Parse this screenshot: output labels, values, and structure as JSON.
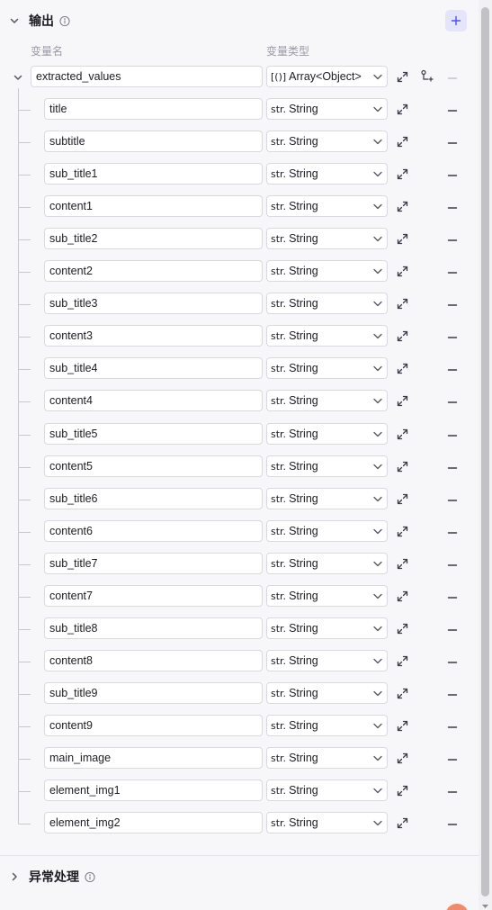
{
  "output_section": {
    "title": "输出",
    "add_icon": "plus-icon",
    "info_icon": "info-icon"
  },
  "columns": {
    "name": "变量名",
    "type": "变量类型"
  },
  "parent_field": {
    "name": "extracted_values",
    "type_prefix": "[()]",
    "type_label": "Array<Object>"
  },
  "child_type": {
    "prefix": "str.",
    "label": "String"
  },
  "fields": [
    "title",
    "subtitle",
    "sub_title1",
    "content1",
    "sub_title2",
    "content2",
    "sub_title3",
    "content3",
    "sub_title4",
    "content4",
    "sub_title5",
    "content5",
    "sub_title6",
    "content6",
    "sub_title7",
    "content7",
    "sub_title8",
    "content8",
    "sub_title9",
    "content9",
    "main_image",
    "element_img1",
    "element_img2"
  ],
  "exception_section": {
    "title": "异常处理"
  },
  "colors": {
    "accent": "#4d53e8",
    "add_button_bg": "#e4e4fb",
    "border": "#d9d9e2",
    "muted_text": "#9a9aa6"
  }
}
